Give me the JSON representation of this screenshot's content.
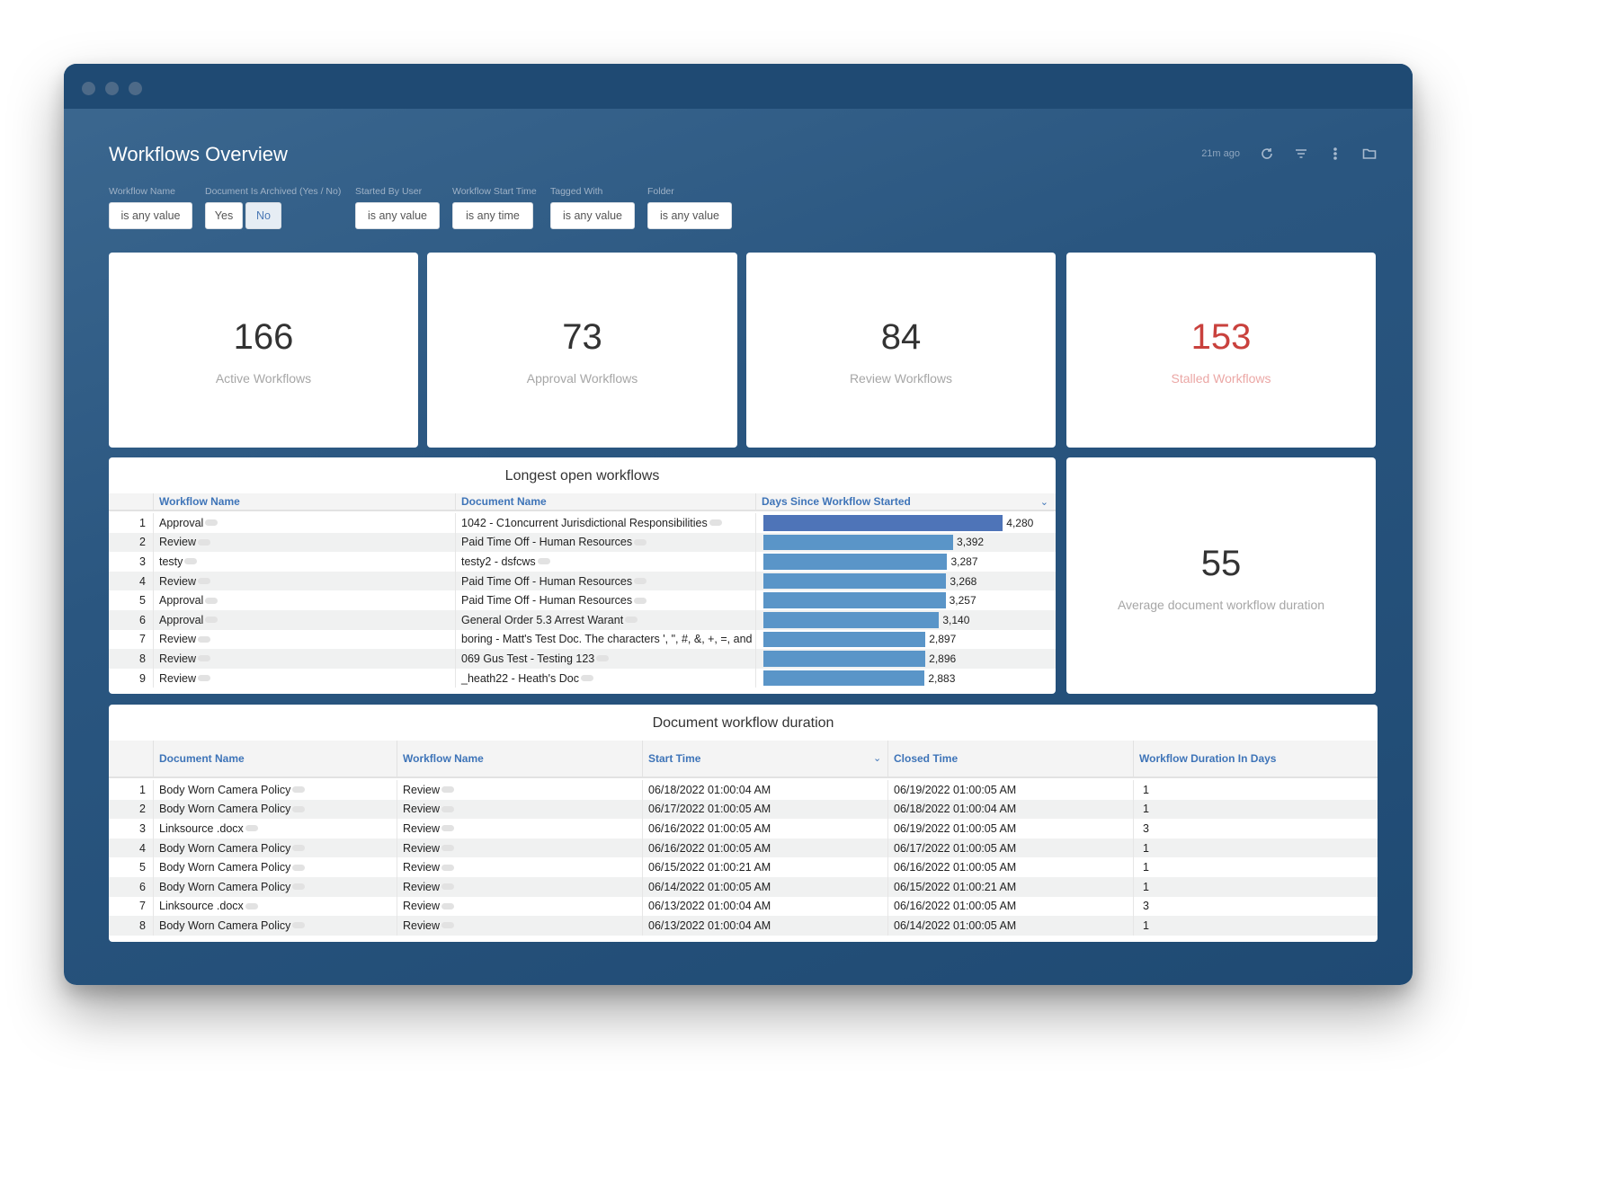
{
  "header": {
    "title": "Workflows Overview",
    "last_updated": "21m ago"
  },
  "filters": [
    {
      "label": "Workflow Name",
      "value": "is any value"
    },
    {
      "label": "Document Is Archived (Yes / No)",
      "options": [
        "Yes",
        "No"
      ],
      "selected": "No"
    },
    {
      "label": "Started By User",
      "value": "is any value"
    },
    {
      "label": "Workflow Start Time",
      "value": "is any time"
    },
    {
      "label": "Tagged With",
      "value": "is any value"
    },
    {
      "label": "Folder",
      "value": "is any value"
    }
  ],
  "kpis": [
    {
      "value": "166",
      "label": "Active Workflows"
    },
    {
      "value": "73",
      "label": "Approval Workflows"
    },
    {
      "value": "84",
      "label": "Review Workflows"
    },
    {
      "value": "153",
      "label": "Stalled Workflows",
      "color": "#c9413d",
      "label_color": "#eba7a5"
    }
  ],
  "average": {
    "value": "55",
    "label": "Average document workflow duration"
  },
  "longest": {
    "title": "Longest open workflows",
    "columns": [
      "Workflow Name",
      "Document Name",
      "Days Since Workflow Started"
    ],
    "bar_color": "#5a95c8",
    "top_bar_color": "#4e74b8",
    "rows": [
      {
        "n": "1",
        "workflow": "Approval",
        "document": "1042 - C1oncurrent Jurisdictional Responsibilities",
        "days": 4280,
        "days_label": "4,280"
      },
      {
        "n": "2",
        "workflow": "Review",
        "document": "Paid Time Off - Human Resources",
        "days": 3392,
        "days_label": "3,392"
      },
      {
        "n": "3",
        "workflow": "testy",
        "document": "testy2 - dsfcws",
        "days": 3287,
        "days_label": "3,287"
      },
      {
        "n": "4",
        "workflow": "Review",
        "document": "Paid Time Off - Human Resources",
        "days": 3268,
        "days_label": "3,268"
      },
      {
        "n": "5",
        "workflow": "Approval",
        "document": "Paid Time Off - Human Resources",
        "days": 3257,
        "days_label": "3,257"
      },
      {
        "n": "6",
        "workflow": "Approval",
        "document": "General Order 5.3 Arrest Warant",
        "days": 3140,
        "days_label": "3,140"
      },
      {
        "n": "7",
        "workflow": "Review",
        "document": "boring - Matt's Test Doc. The characters ', \", #, &, +, =, and ...",
        "days": 2897,
        "days_label": "2,897"
      },
      {
        "n": "8",
        "workflow": "Review",
        "document": "069 Gus Test - Testing 123",
        "days": 2896,
        "days_label": "2,896"
      },
      {
        "n": "9",
        "workflow": "Review",
        "document": "_heath22 - Heath's Doc",
        "days": 2883,
        "days_label": "2,883"
      }
    ]
  },
  "duration": {
    "title": "Document workflow duration",
    "columns": [
      "Document Name",
      "Workflow Name",
      "Start Time",
      "Closed Time",
      "Workflow Duration In Days"
    ],
    "rows": [
      {
        "n": "1",
        "document": "Body Worn Camera Policy",
        "workflow": "Review",
        "start": "06/18/2022 01:00:04 AM",
        "closed": "06/19/2022 01:00:05 AM",
        "days": "1"
      },
      {
        "n": "2",
        "document": "Body Worn Camera Policy",
        "workflow": "Review",
        "start": "06/17/2022 01:00:05 AM",
        "closed": "06/18/2022 01:00:04 AM",
        "days": "1"
      },
      {
        "n": "3",
        "document": "Linksource .docx",
        "workflow": "Review",
        "start": "06/16/2022 01:00:05 AM",
        "closed": "06/19/2022 01:00:05 AM",
        "days": "3"
      },
      {
        "n": "4",
        "document": "Body Worn Camera Policy",
        "workflow": "Review",
        "start": "06/16/2022 01:00:05 AM",
        "closed": "06/17/2022 01:00:05 AM",
        "days": "1"
      },
      {
        "n": "5",
        "document": "Body Worn Camera Policy",
        "workflow": "Review",
        "start": "06/15/2022 01:00:21 AM",
        "closed": "06/16/2022 01:00:05 AM",
        "days": "1"
      },
      {
        "n": "6",
        "document": "Body Worn Camera Policy",
        "workflow": "Review",
        "start": "06/14/2022 01:00:05 AM",
        "closed": "06/15/2022 01:00:21 AM",
        "days": "1"
      },
      {
        "n": "7",
        "document": "Linksource .docx",
        "workflow": "Review",
        "start": "06/13/2022 01:00:04 AM",
        "closed": "06/16/2022 01:00:05 AM",
        "days": "3"
      },
      {
        "n": "8",
        "document": "Body Worn Camera Policy",
        "workflow": "Review",
        "start": "06/13/2022 01:00:04 AM",
        "closed": "06/14/2022 01:00:05 AM",
        "days": "1"
      }
    ]
  }
}
